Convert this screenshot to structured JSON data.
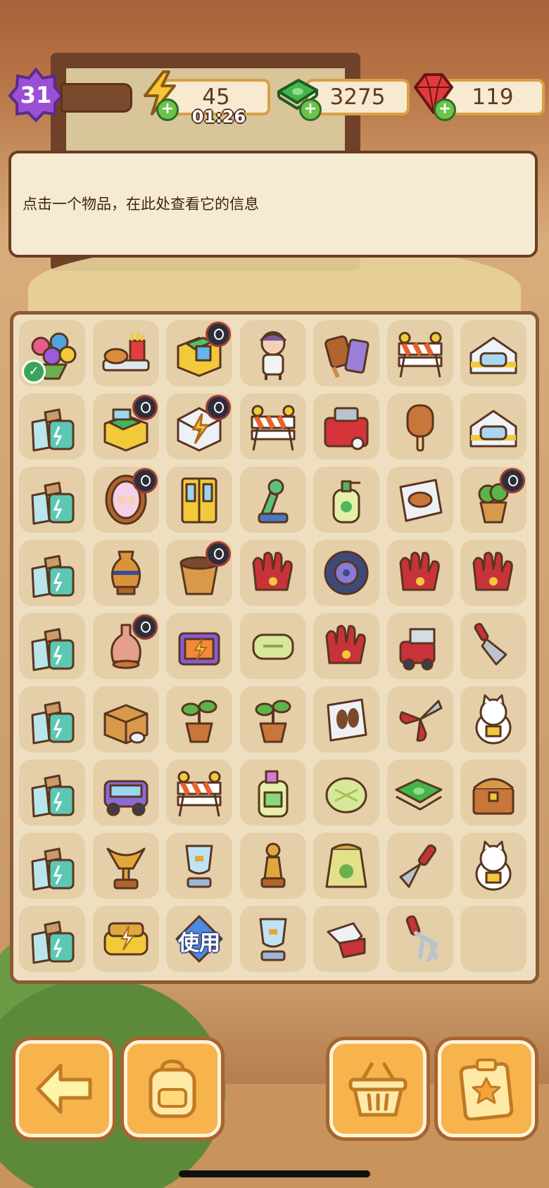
{
  "player": {
    "level": "31"
  },
  "resources": {
    "energy": {
      "value": "45",
      "timer": "01:26",
      "icon": "lightning-bolt"
    },
    "cash": {
      "value": "3275",
      "icon": "cash-stack"
    },
    "gems": {
      "value": "119",
      "icon": "red-gem"
    }
  },
  "info_panel": {
    "text": "点击一个物品，在此处查看它的信息"
  },
  "board": {
    "cells": [
      [
        "flower-bouquet",
        "burger-meal",
        "green-toolbox",
        "girl-character",
        "waffle-snack",
        "road-barrier",
        "pet-bed"
      ],
      [
        "energy-bottle-box",
        "toolbox-open",
        "energy-generator",
        "road-barrier",
        "toolbox-generator",
        "ice-pop",
        "pet-bed"
      ],
      [
        "energy-bottle-box",
        "mirror-photo",
        "wardrobe",
        "green-figurine",
        "soap-dispenser",
        "sandwich-bag",
        "potted-plant"
      ],
      [
        "energy-bottle-box",
        "amphora-vase",
        "plant-pot-empty",
        "baseball-glove",
        "tire",
        "baseball-glove",
        "baseball-glove"
      ],
      [
        "energy-bottle-box",
        "glass-vase",
        "energy-dresser",
        "soap-bar",
        "baseball-glove",
        "cart-generator",
        "garden-rake"
      ],
      [
        "energy-bottle-box",
        "wooden-crate",
        "sprout-pot",
        "sprout-pot",
        "shoe-bag",
        "pruning-shears",
        "lucky-cat"
      ],
      [
        "energy-bottle-box",
        "energy-car",
        "road-barrier",
        "detergent-bottle",
        "melon-bun",
        "cash-stack",
        "treasure-chest"
      ],
      [
        "energy-bottle-box",
        "trophy-gold",
        "trophy-glass",
        "statue-gold",
        "seed-bag",
        "trowel",
        "lucky-cat"
      ],
      [
        "energy-bottle-box",
        "energy-sofa",
        "use-diamond",
        "trophy-glass",
        "work-gloves",
        "garden-fork",
        "empty"
      ]
    ],
    "use_label": "使用"
  },
  "buttons": {
    "back": {
      "icon": "arrow-left-icon"
    },
    "bag": {
      "icon": "backpack-icon"
    },
    "basket": {
      "icon": "basket-icon"
    },
    "orders": {
      "icon": "star-clipboard-icon"
    }
  },
  "colors": {
    "accent": "#f7b44c",
    "panel": "#f5ead2",
    "board": "#efdfc1",
    "cell": "#e4cfa9"
  }
}
